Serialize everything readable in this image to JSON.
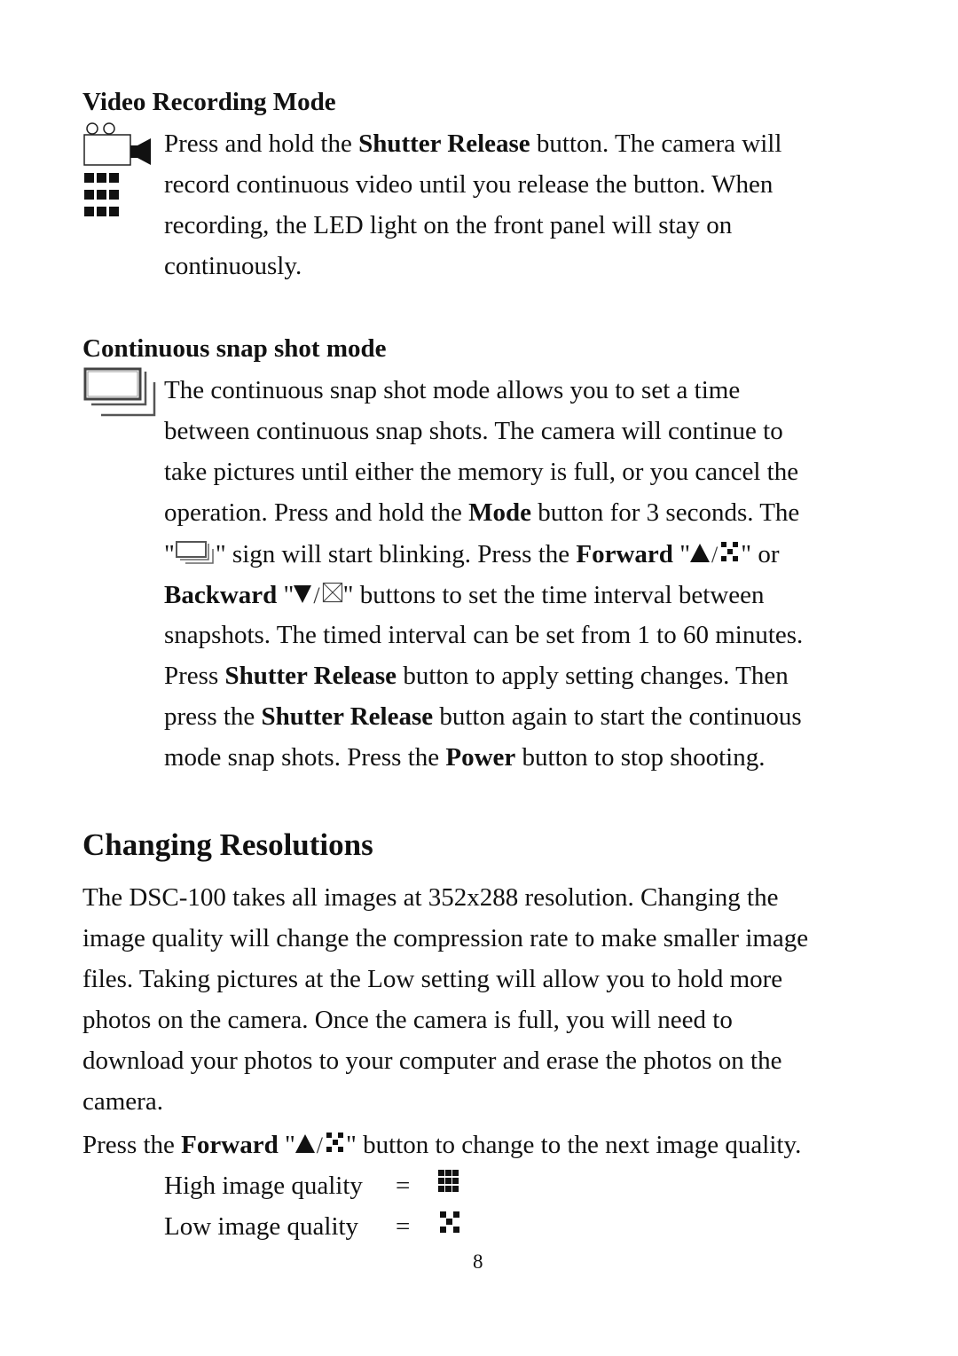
{
  "sections": {
    "video": {
      "heading": "Video Recording Mode",
      "icon": "video-camera-icon",
      "lines": [
        {
          "pre": "Press and hold the ",
          "bold": "Shutter Release",
          "post": " button. The camera will"
        },
        {
          "text": "record continuous video until you release the button. When"
        },
        {
          "text": "recording, the LED light on the front panel will stay on"
        },
        {
          "text": "continuously."
        }
      ]
    },
    "continuous": {
      "heading": "Continuous snap shot mode",
      "icon": "continuous-snapshot-icon",
      "lines": [
        {
          "text": "The continuous snap shot mode allows you to set a time"
        },
        {
          "text": "between continuous snap shots. The camera will continue to"
        },
        {
          "text": "take pictures until either the memory is full, or you cancel the"
        },
        {
          "pre": "operation. Press and hold the ",
          "bold": "Mode",
          "post": " button for 3 seconds. The"
        },
        {
          "q1": "\"",
          "q2": "\" sign will start blinking. Press the ",
          "bold": "Forward",
          "q3": " \"",
          "q4": "\" or"
        },
        {
          "bold": "Backward",
          "q1": " \"",
          "q2": "\" buttons to set the time interval between"
        },
        {
          "text": "snapshots. The timed interval can be set from 1 to 60 minutes."
        },
        {
          "pre": "Press ",
          "bold": "Shutter Release",
          "post": " button to apply setting changes. Then"
        },
        {
          "pre": "press the ",
          "bold": "Shutter Release",
          "post": " button again to start the continuous"
        },
        {
          "pre": "mode snap shots. Press the ",
          "bold": "Power",
          "post": " button to stop shooting."
        }
      ]
    },
    "resolutions": {
      "heading": "Changing Resolutions",
      "lines": [
        {
          "text": "The DSC-100 takes all images at 352x288 resolution. Changing the"
        },
        {
          "text": "image quality will change the compression rate to make smaller image"
        },
        {
          "text": "files. Taking pictures at the Low setting will allow you to hold more"
        },
        {
          "text": "photos on the camera. Once the camera is full, you will need to"
        },
        {
          "text": "download your photos to your computer and erase the photos on the"
        },
        {
          "text": "camera."
        }
      ],
      "forward_line": {
        "pre": "Press the ",
        "bold": "Forward",
        "q1": " \"",
        "q2": "\" button to change to the next image quality."
      },
      "quality": [
        {
          "label": "High image quality",
          "eq": "=",
          "icon": "high-quality-icon"
        },
        {
          "label": "Low image quality",
          "eq": "=",
          "icon": "low-quality-icon"
        }
      ]
    }
  },
  "footer": {
    "page_number": "8"
  },
  "icons": {
    "forward": "triangle-up-icon",
    "low_quality": "low-quality-icon",
    "backward": "triangle-down-icon",
    "cancel": "crossed-box-icon"
  }
}
